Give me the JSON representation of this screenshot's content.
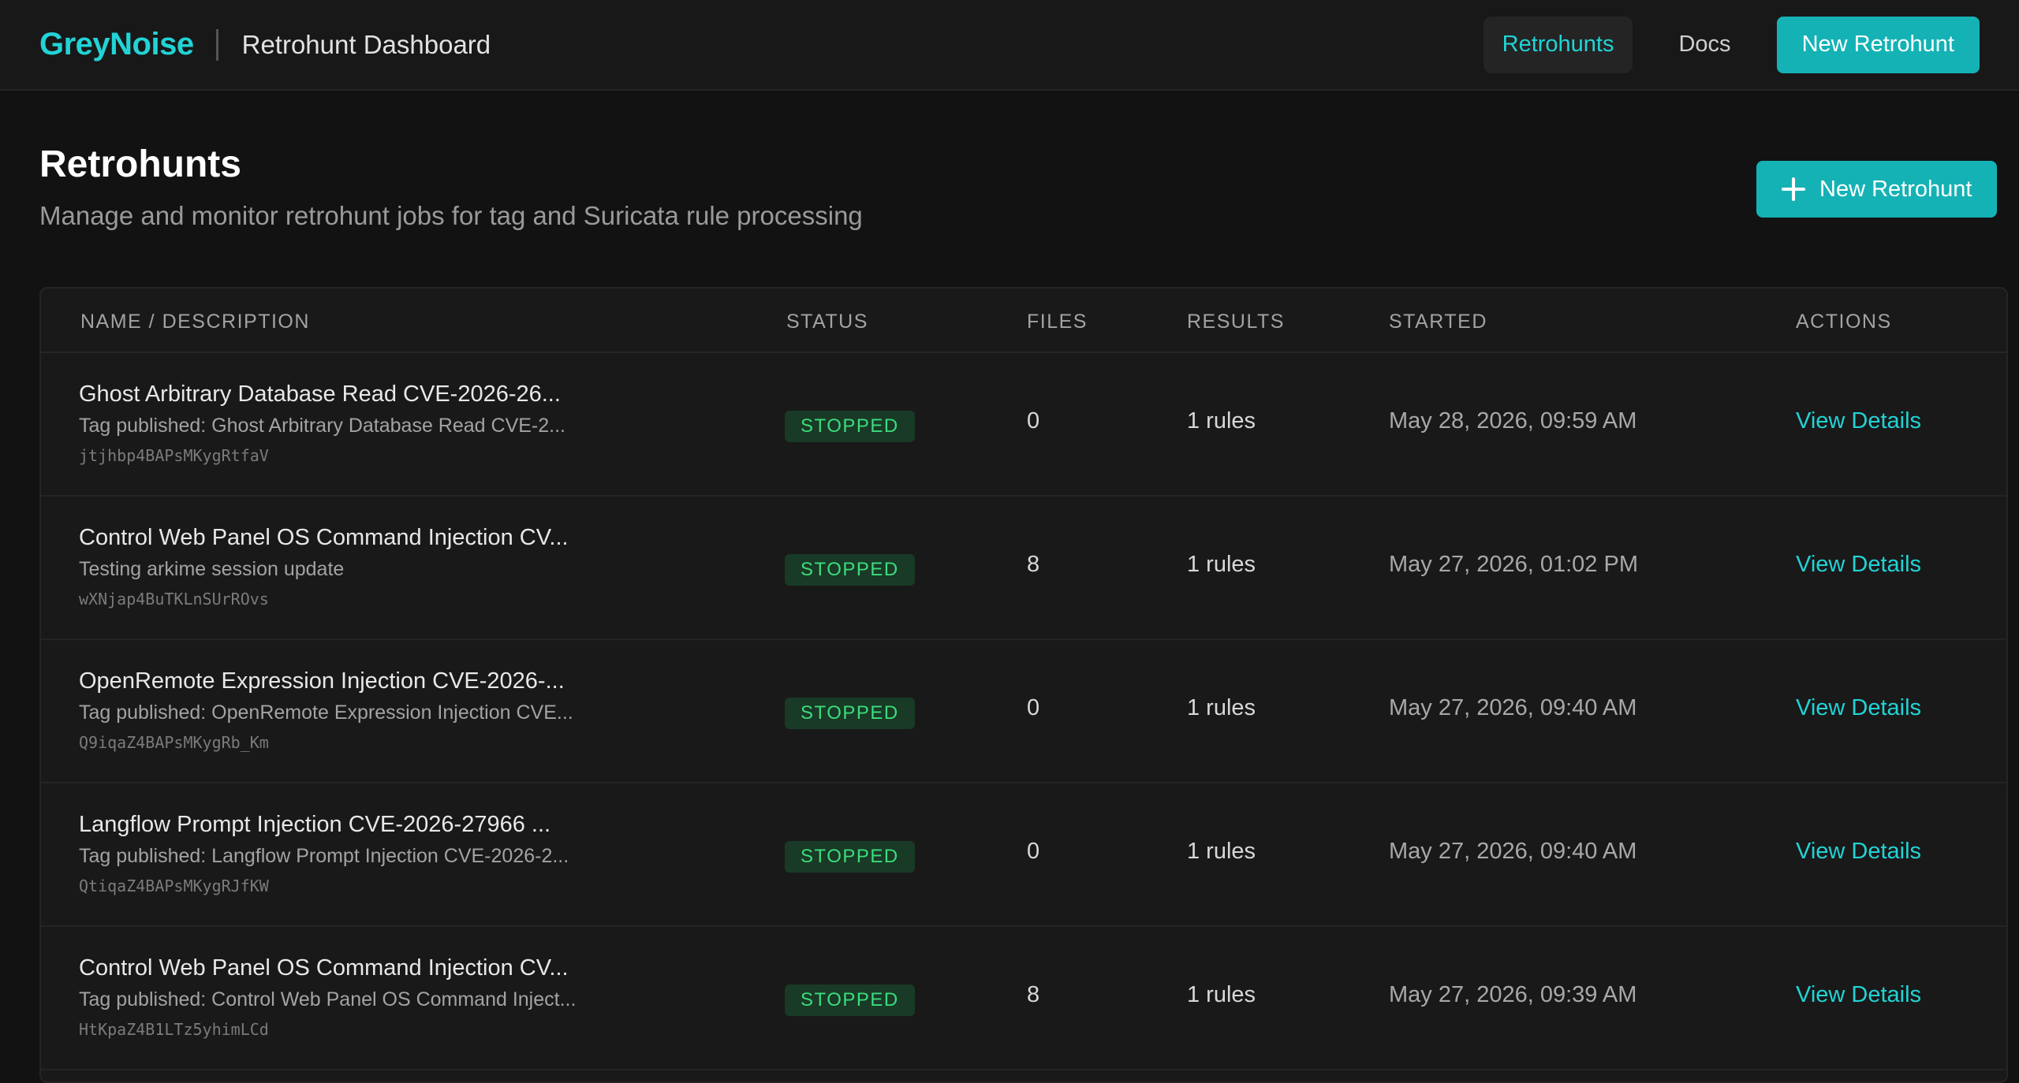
{
  "header": {
    "brand": "GreyNoise",
    "app_title": "Retrohunt Dashboard",
    "nav": {
      "retrohunts": "Retrohunts",
      "docs": "Docs"
    },
    "new_button": "New Retrohunt"
  },
  "page": {
    "title": "Retrohunts",
    "subtitle": "Manage and monitor retrohunt jobs for tag and Suricata rule processing",
    "new_button": "New Retrohunt"
  },
  "table": {
    "columns": {
      "name": "NAME / DESCRIPTION",
      "status": "STATUS",
      "files": "FILES",
      "results": "RESULTS",
      "started": "STARTED",
      "actions": "ACTIONS"
    },
    "rows": [
      {
        "name": "Ghost Arbitrary Database Read CVE-2026-26...",
        "description": "Tag published: Ghost Arbitrary Database Read CVE-2...",
        "id": "jtjhbp4BAPsMKygRtfaV",
        "status": "STOPPED",
        "files": "0",
        "results": "1 rules",
        "started": "May 28, 2026, 09:59 AM",
        "action": "View Details"
      },
      {
        "name": "Control Web Panel OS Command Injection CV...",
        "description": "Testing arkime session update",
        "id": "wXNjap4BuTKLnSUrROvs",
        "status": "STOPPED",
        "files": "8",
        "results": "1 rules",
        "started": "May 27, 2026, 01:02 PM",
        "action": "View Details"
      },
      {
        "name": "OpenRemote Expression Injection CVE-2026-...",
        "description": "Tag published: OpenRemote Expression Injection CVE...",
        "id": "Q9iqaZ4BAPsMKygRb_Km",
        "status": "STOPPED",
        "files": "0",
        "results": "1 rules",
        "started": "May 27, 2026, 09:40 AM",
        "action": "View Details"
      },
      {
        "name": "Langflow Prompt Injection CVE-2026-27966 ...",
        "description": "Tag published: Langflow Prompt Injection CVE-2026-2...",
        "id": "QtiqaZ4BAPsMKygRJfKW",
        "status": "STOPPED",
        "files": "0",
        "results": "1 rules",
        "started": "May 27, 2026, 09:40 AM",
        "action": "View Details"
      },
      {
        "name": "Control Web Panel OS Command Injection CV...",
        "description": "Tag published: Control Web Panel OS Command Inject...",
        "id": "HtKpaZ4B1LTz5yhimLCd",
        "status": "STOPPED",
        "files": "8",
        "results": "1 rules",
        "started": "May 27, 2026, 09:39 AM",
        "action": "View Details"
      }
    ]
  },
  "colors": {
    "accent": "#22d3d6",
    "primary_button": "#14b2b5",
    "status_stopped_bg": "#183a26",
    "status_stopped_text": "#3ddc7d",
    "background": "#121212"
  }
}
